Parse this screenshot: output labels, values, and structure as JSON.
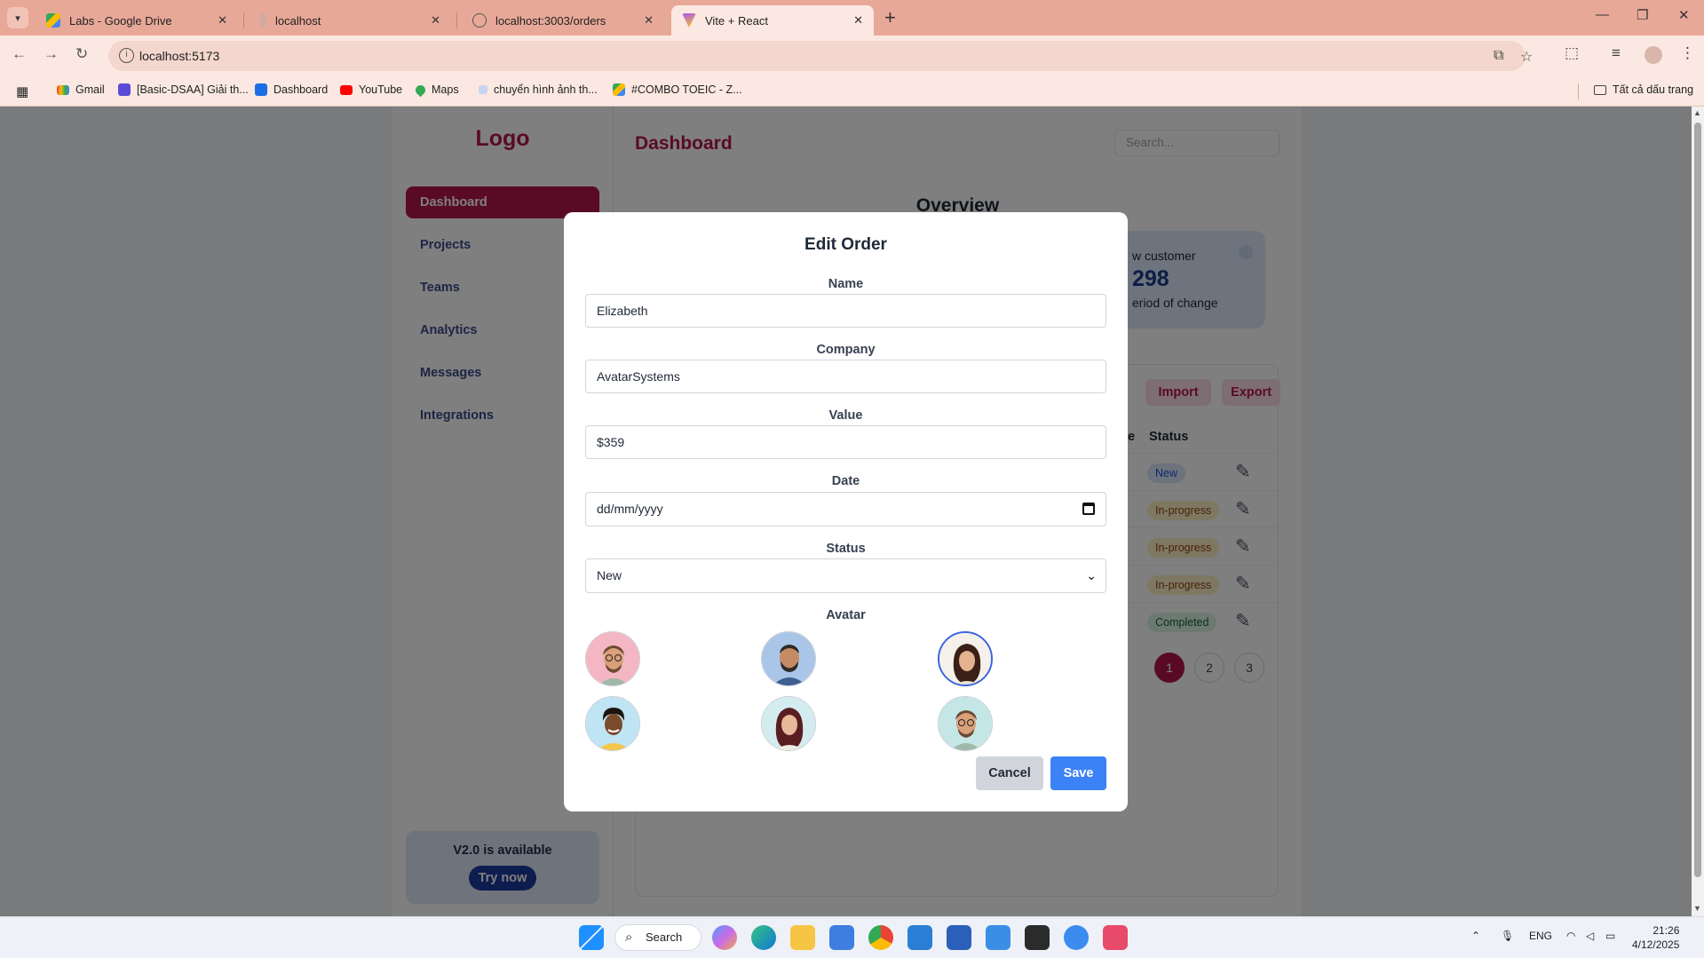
{
  "browser": {
    "tabs": [
      {
        "title": "Labs - Google Drive",
        "active": false
      },
      {
        "title": "localhost",
        "active": false
      },
      {
        "title": "localhost:3003/orders",
        "active": false
      },
      {
        "title": "Vite + React",
        "active": true
      }
    ],
    "url": "localhost:5173",
    "bookmarks": [
      {
        "label": "Gmail"
      },
      {
        "label": "[Basic-DSAA] Giải th..."
      },
      {
        "label": "Dashboard"
      },
      {
        "label": "YouTube"
      },
      {
        "label": "Maps"
      },
      {
        "label": "chuyển hình ảnh th..."
      },
      {
        "label": "#COMBO TOEIC - Z..."
      }
    ],
    "all_bookmarks": "Tất cả dấu trang"
  },
  "sidebar": {
    "logo": "Logo",
    "items": [
      {
        "label": "Dashboard",
        "active": true
      },
      {
        "label": "Projects"
      },
      {
        "label": "Teams"
      },
      {
        "label": "Analytics"
      },
      {
        "label": "Messages"
      },
      {
        "label": "Integrations"
      }
    ],
    "promo": {
      "text": "V2.0 is available",
      "button": "Try now"
    }
  },
  "main": {
    "title": "Dashboard",
    "search_placeholder": "Search...",
    "overview": "Overview",
    "stat": {
      "label": "w customer",
      "value": "298",
      "sub": "eriod of change"
    },
    "buttons": {
      "import": "Import",
      "export": "Export"
    },
    "table_header": {
      "status_fragment": "e",
      "status": "Status"
    },
    "rows": [
      {
        "status": "New",
        "fragment": ""
      },
      {
        "status": "In-progress",
        "fragment": ""
      },
      {
        "status": "In-progress",
        "fragment": ""
      },
      {
        "status": "In-progress",
        "fragment": ""
      },
      {
        "status": "Completed",
        "fragment": ""
      }
    ],
    "pagination": [
      "1",
      "2",
      "3"
    ],
    "status_colors": {
      "New": {
        "bg": "#dbe6fb",
        "fg": "#1d4ed8"
      },
      "In-progress": {
        "bg": "#fdf0c4",
        "fg": "#92400e"
      },
      "Completed": {
        "bg": "#d9f5e3",
        "fg": "#166534"
      }
    }
  },
  "modal": {
    "title": "Edit Order",
    "fields": {
      "name": {
        "label": "Name",
        "value": "Elizabeth"
      },
      "company": {
        "label": "Company",
        "value": "AvatarSystems"
      },
      "value": {
        "label": "Value",
        "value": "$359"
      },
      "date": {
        "label": "Date",
        "value": "dd/mm/yyyy"
      },
      "status": {
        "label": "Status",
        "value": "New"
      }
    },
    "avatar_label": "Avatar",
    "avatars": [
      {
        "name": "avatar-man-glasses-pink",
        "selected": false
      },
      {
        "name": "avatar-man-beard-blue",
        "selected": false
      },
      {
        "name": "avatar-woman-dark-hair",
        "selected": true
      },
      {
        "name": "avatar-man-curly-yellow",
        "selected": false
      },
      {
        "name": "avatar-woman-dark-hair-2",
        "selected": false
      },
      {
        "name": "avatar-man-glasses-teal",
        "selected": false
      }
    ],
    "cancel": "Cancel",
    "save": "Save"
  },
  "taskbar": {
    "search": "Search",
    "lang": "ENG",
    "time": "21:26",
    "date": "4/12/2025"
  },
  "colors": {
    "brand": "#b3164d",
    "nav_text": "#3b4a8c",
    "save_button": "#3b82f6",
    "cancel_button": "#d1d5db"
  }
}
